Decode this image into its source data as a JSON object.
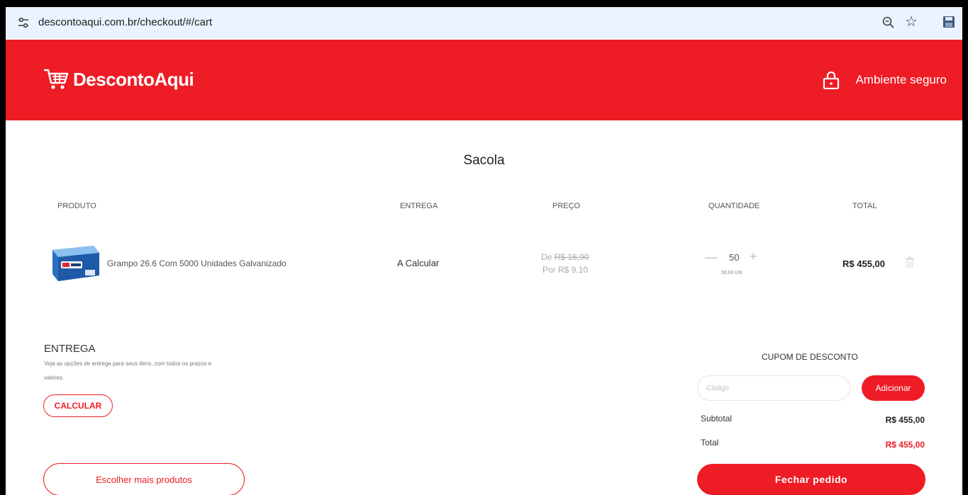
{
  "browser": {
    "url": "descontoaqui.com.br/checkout/#/cart",
    "icons": [
      "tune-icon",
      "zoom-icon",
      "star-icon",
      "save-icon"
    ]
  },
  "header": {
    "brand": "DescontoAqui",
    "secure_label": "Ambiente seguro",
    "brand_color": "#ee1c25"
  },
  "cart": {
    "title": "Sacola",
    "columns": {
      "product": "PRODUTO",
      "delivery": "ENTREGA",
      "price": "PREÇO",
      "quantity": "QUANTIDADE",
      "total": "TOTAL"
    },
    "items": [
      {
        "name": "Grampo 26.6 Com 5000 Unidades Galvanizado",
        "delivery": "A Calcular",
        "price_old_prefix": "De ",
        "price_old": "R$ 16,90",
        "price_new": "Por R$ 9,10",
        "qty_minus": "—",
        "qty": "50",
        "qty_plus": "+",
        "qty_unit": "50.00 UN",
        "total": "R$ 455,00"
      }
    ]
  },
  "shipping": {
    "title": "ENTREGA",
    "description": "Veja as opções de entrega para seus itens, com todos os prazos e valores.",
    "calc_button": "CALCULAR",
    "more_button": "Escolher mais produtos"
  },
  "coupon": {
    "title": "CUPOM DE DESCONTO",
    "placeholder": "Código",
    "add_button": "Adicionar"
  },
  "summary": {
    "subtotal_label": "Subtotal",
    "subtotal_value": "R$ 455,00",
    "total_label": "Total",
    "total_value": "R$ 455,00",
    "close_button": "Fechar pedido"
  }
}
